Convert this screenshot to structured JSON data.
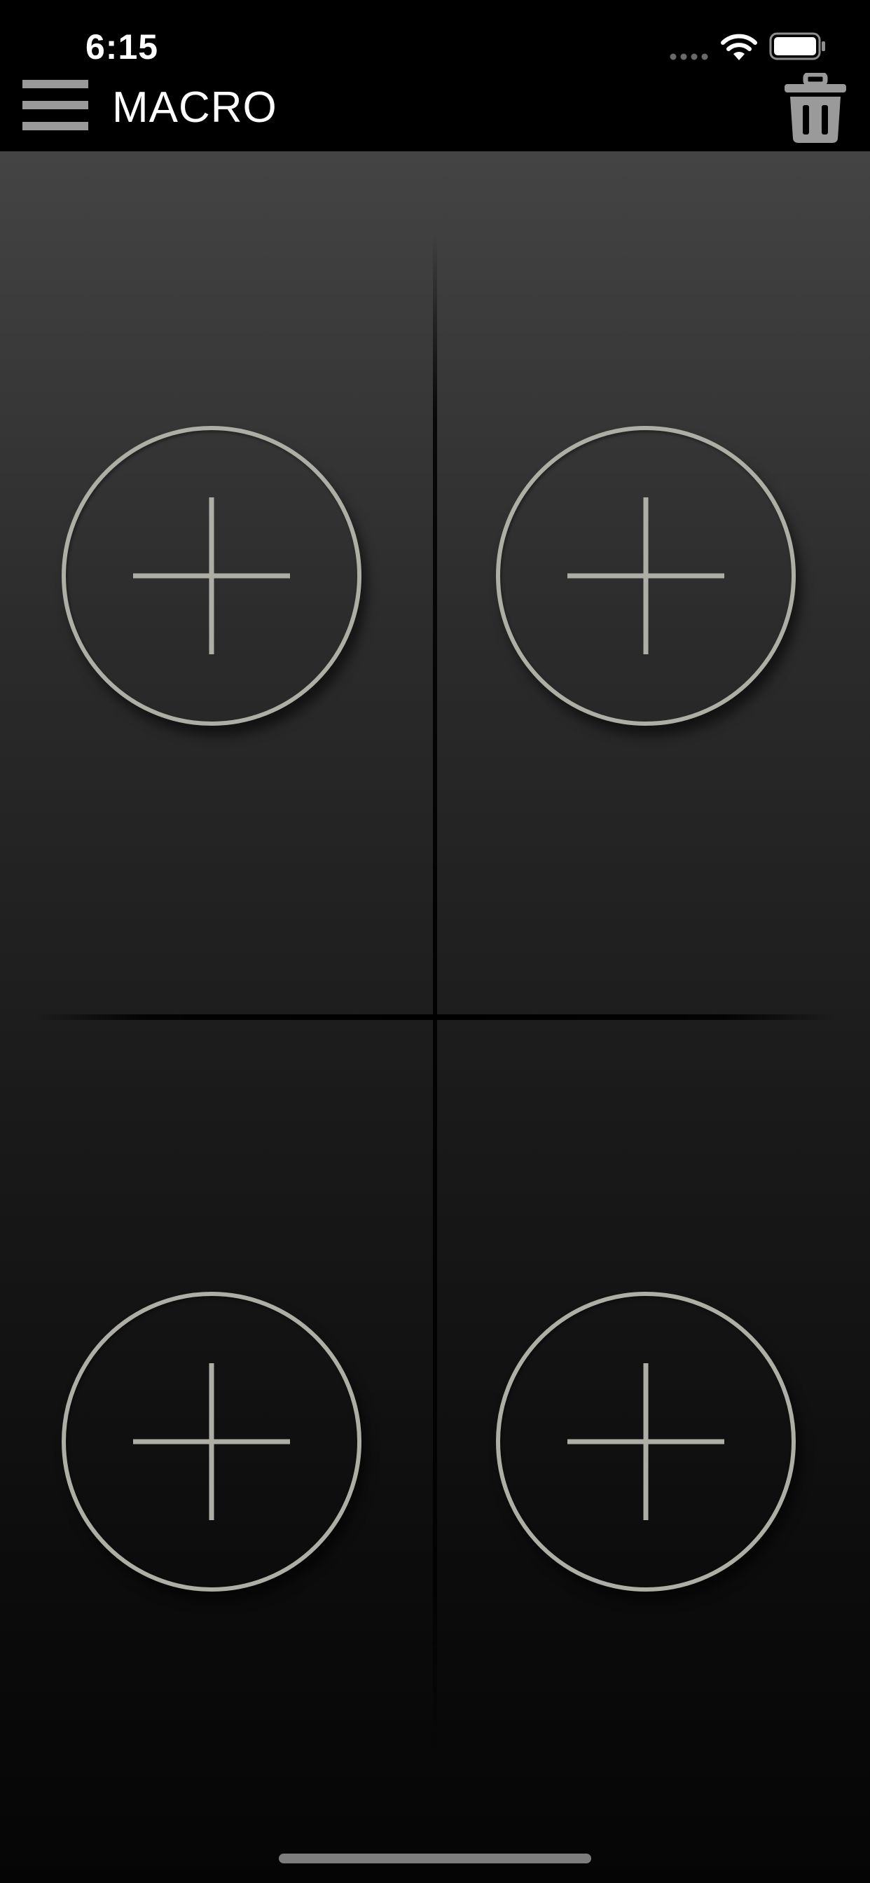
{
  "status_bar": {
    "time": "6:15",
    "icons": [
      "signal-icon",
      "wifi-icon",
      "battery-icon"
    ]
  },
  "header": {
    "title": "MACRO",
    "menu_icon": "hamburger-menu-icon",
    "delete_icon": "trash-icon"
  },
  "macro_slots": [
    {
      "slot": 1,
      "icon": "plus-icon",
      "state": "empty"
    },
    {
      "slot": 2,
      "icon": "plus-icon",
      "state": "empty"
    },
    {
      "slot": 3,
      "icon": "plus-icon",
      "state": "empty"
    },
    {
      "slot": 4,
      "icon": "plus-icon",
      "state": "empty"
    }
  ],
  "colors": {
    "header_background": "#000000",
    "title_text": "#ffffff",
    "icon_gray": "#9a9a9a",
    "slot_ring": "#aeaea6",
    "gradient_top": "#444444",
    "gradient_bottom": "#050505"
  }
}
